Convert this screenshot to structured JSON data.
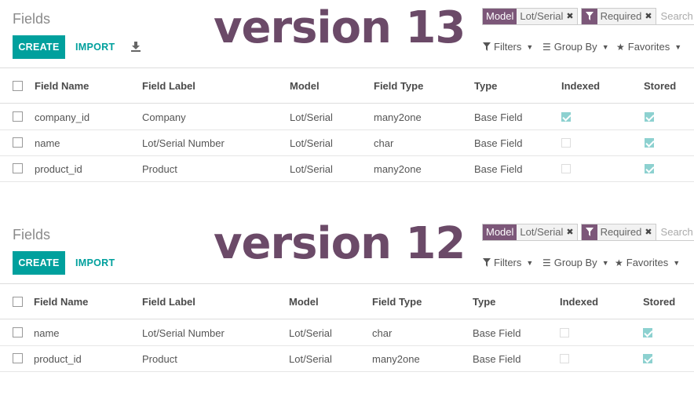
{
  "panels": [
    {
      "title": "Fields",
      "version": "version 13",
      "create_label": "CREATE",
      "import_label": "IMPORT",
      "search": {
        "facets": [
          {
            "label": "Model",
            "value": "Lot/Serial"
          },
          {
            "label": "filter-icon",
            "value": "Required"
          }
        ],
        "placeholder": "Search..."
      },
      "filters_label": "Filters",
      "groupby_label": "Group By",
      "favorites_label": "Favorites",
      "columns": [
        "Field Name",
        "Field Label",
        "Model",
        "Field Type",
        "Type",
        "Indexed",
        "Stored"
      ],
      "rows": [
        {
          "name": "company_id",
          "label": "Company",
          "model": "Lot/Serial",
          "ftype": "many2one",
          "type": "Base Field",
          "indexed": true,
          "stored": true
        },
        {
          "name": "name",
          "label": "Lot/Serial Number",
          "model": "Lot/Serial",
          "ftype": "char",
          "type": "Base Field",
          "indexed": false,
          "stored": true
        },
        {
          "name": "product_id",
          "label": "Product",
          "model": "Lot/Serial",
          "ftype": "many2one",
          "type": "Base Field",
          "indexed": false,
          "stored": true
        }
      ]
    },
    {
      "title": "Fields",
      "version": "version 12",
      "create_label": "CREATE",
      "import_label": "IMPORT",
      "search": {
        "facets": [
          {
            "label": "Model",
            "value": "Lot/Serial"
          },
          {
            "label": "filter-icon",
            "value": "Required"
          }
        ],
        "placeholder": "Search..."
      },
      "filters_label": "Filters",
      "groupby_label": "Group By",
      "favorites_label": "Favorites",
      "columns": [
        "Field Name",
        "Field Label",
        "Model",
        "Field Type",
        "Type",
        "Indexed",
        "Stored"
      ],
      "rows": [
        {
          "name": "name",
          "label": "Lot/Serial Number",
          "model": "Lot/Serial",
          "ftype": "char",
          "type": "Base Field",
          "indexed": false,
          "stored": true
        },
        {
          "name": "product_id",
          "label": "Product",
          "model": "Lot/Serial",
          "ftype": "many2one",
          "type": "Base Field",
          "indexed": false,
          "stored": true
        }
      ]
    }
  ],
  "colors": {
    "accent": "#00a09d",
    "facet": "#7c5779",
    "version": "#6b4a68",
    "check": "#8dd1d0"
  }
}
